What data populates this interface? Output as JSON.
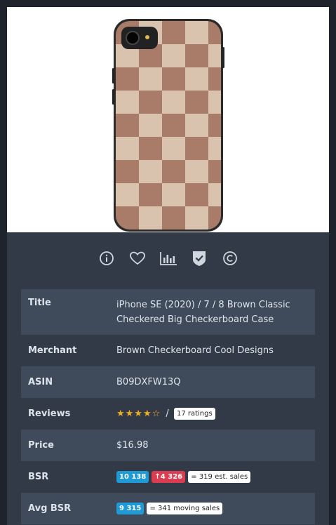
{
  "product": {
    "image_alt": "Brown checkerboard iPhone case",
    "title": "iPhone SE (2020) / 7 / 8 Brown Classic Checkered Big Checkerboard Case",
    "merchant": "Brown Checkerboard Cool Designs",
    "asin": "B09DXFW13Q",
    "reviews": {
      "stars": "★★★★☆",
      "separator": "/",
      "ratings": "17 ratings",
      "rating_value": 4
    },
    "price": "$16.98",
    "bsr": {
      "rank": "10 138",
      "change": "↑4 326",
      "est_sales": "= 319 est. sales"
    },
    "avg_bsr": {
      "rank": "9 315",
      "moving_sales": "= 341 moving sales"
    }
  },
  "labels": {
    "title": "Title",
    "merchant": "Merchant",
    "asin": "ASIN",
    "reviews": "Reviews",
    "price": "Price",
    "bsr": "BSR",
    "avg_bsr": "Avg BSR"
  },
  "actions": [
    "info-icon",
    "heart-icon",
    "chart-icon",
    "shield-check-icon",
    "copyright-icon"
  ],
  "colors": {
    "accent": "#35b89a",
    "star": "#f2b01e",
    "pill_blue": "#1e9bd7",
    "pill_red": "#dc3c4f",
    "panel": "#323a47",
    "row_alt": "#3f4a5a"
  }
}
